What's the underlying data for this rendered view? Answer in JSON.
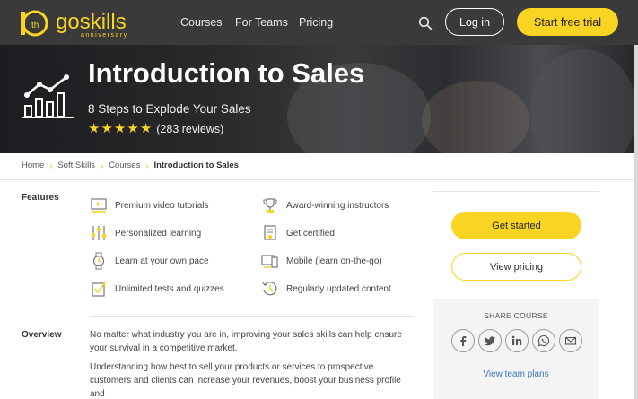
{
  "nav": {
    "logo_text": "goskills",
    "logo_sub": "anniversary",
    "logo_badge": "th",
    "links": [
      "Courses",
      "For Teams",
      "Pricing"
    ],
    "login_label": "Log in",
    "trial_label": "Start free trial"
  },
  "hero": {
    "title": "Introduction to Sales",
    "subtitle": "8 Steps to Explode Your Sales",
    "rating": 5,
    "reviews": "(283 reviews)"
  },
  "breadcrumb": {
    "items": [
      "Home",
      "Soft Skills",
      "Courses",
      "Introduction to Sales"
    ]
  },
  "features": {
    "label": "Features",
    "items": [
      {
        "label": "Premium video tutorials",
        "icon": "video-icon"
      },
      {
        "label": "Award-winning instructors",
        "icon": "trophy-icon"
      },
      {
        "label": "Personalized learning",
        "icon": "sliders-icon"
      },
      {
        "label": "Get certified",
        "icon": "certificate-icon"
      },
      {
        "label": "Learn at your own pace",
        "icon": "watch-icon"
      },
      {
        "label": "Mobile (learn on-the-go)",
        "icon": "mobile-icon"
      },
      {
        "label": "Unlimited tests and quizzes",
        "icon": "quiz-icon"
      },
      {
        "label": "Regularly updated content",
        "icon": "clock-icon"
      }
    ]
  },
  "overview": {
    "label": "Overview",
    "p1": "No matter what industry you are in, improving your sales skills can help ensure your survival in a competitive market.",
    "p2": "Understanding how best to sell your products or services to prospective customers and clients can increase your revenues, boost your business profile and"
  },
  "card": {
    "start_label": "Get started",
    "pricing_label": "View pricing",
    "share_label": "SHARE COURSE",
    "share_icons": [
      "facebook-icon",
      "twitter-icon",
      "linkedin-icon",
      "whatsapp-icon",
      "email-icon"
    ],
    "team_plans": "View team plans"
  },
  "colors": {
    "accent": "#f9d422",
    "nav_bg": "#3a3a3a",
    "link_blue": "#3a77c2"
  }
}
